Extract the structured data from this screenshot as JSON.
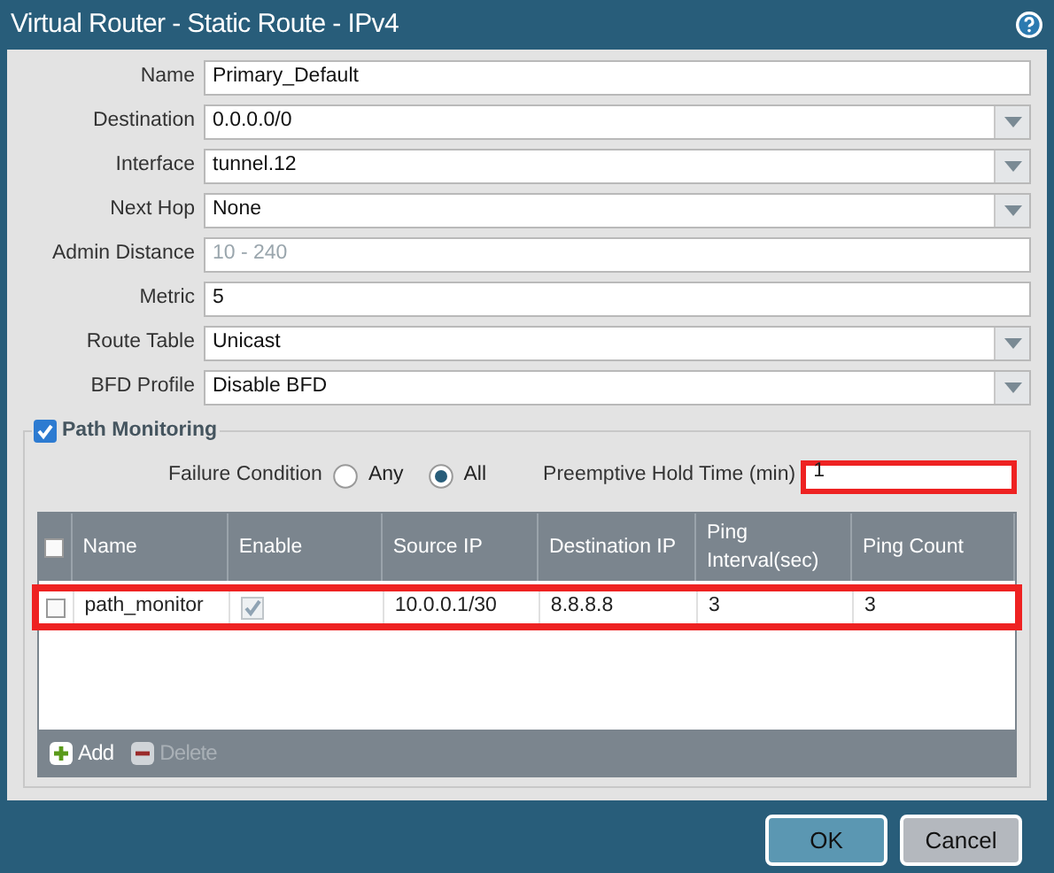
{
  "window": {
    "title": "Virtual Router - Static Route - IPv4"
  },
  "fields": [
    {
      "label": "Name",
      "kind": "text",
      "value": "Primary_Default"
    },
    {
      "label": "Destination",
      "kind": "select",
      "value": "0.0.0.0/0"
    },
    {
      "label": "Interface",
      "kind": "select",
      "value": "tunnel.12"
    },
    {
      "label": "Next Hop",
      "kind": "select",
      "value": "None"
    },
    {
      "label": "Admin Distance",
      "kind": "text",
      "placeholder": "10 - 240"
    },
    {
      "label": "Metric",
      "kind": "text",
      "value": "5"
    },
    {
      "label": "Route Table",
      "kind": "select",
      "value": "Unicast"
    },
    {
      "label": "BFD Profile",
      "kind": "select",
      "value": "Disable BFD"
    }
  ],
  "path_monitoring": {
    "label": "Path Monitoring",
    "checked": true,
    "failure_condition": {
      "label": "Failure Condition",
      "options": [
        {
          "label": "Any",
          "selected": false
        },
        {
          "label": "All",
          "selected": true
        }
      ]
    },
    "preemptive_hold_time": {
      "label": "Preemptive Hold Time (min)",
      "value": "1",
      "highlighted": true
    },
    "table": {
      "select_all_checked": false,
      "columns": [
        "Name",
        "Enable",
        "Source IP",
        "Destination IP",
        "Ping Interval(sec)",
        "Ping Count"
      ],
      "rows": [
        {
          "checked": false,
          "highlighted": true,
          "name": "path_monitor",
          "enable": true,
          "source_ip": "10.0.0.1/30",
          "destination_ip": "8.8.8.8",
          "ping_interval": "3",
          "ping_count": "3"
        }
      ]
    },
    "toolbar": [
      {
        "label": "Add",
        "kind": "add",
        "disabled": false
      },
      {
        "label": "Delete",
        "kind": "delete",
        "disabled": true
      }
    ]
  },
  "buttons": [
    {
      "label": "OK",
      "kind": "primary"
    },
    {
      "label": "Cancel",
      "kind": "secondary"
    }
  ]
}
